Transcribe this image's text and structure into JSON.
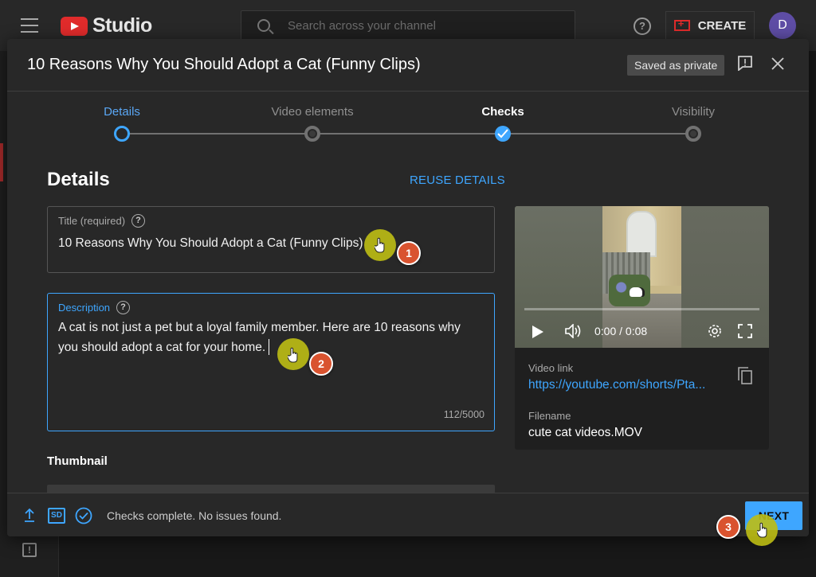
{
  "background": {
    "logo_text": "Studio",
    "search_placeholder": "Search across your channel",
    "create_label": "CREATE",
    "avatar_letter": "D"
  },
  "dialog": {
    "title": "10 Reasons Why You Should Adopt a Cat (Funny Clips)",
    "saved_badge": "Saved as private"
  },
  "steps": [
    {
      "label": "Details",
      "state": "current"
    },
    {
      "label": "Video elements",
      "state": "pending"
    },
    {
      "label": "Checks",
      "state": "done"
    },
    {
      "label": "Visibility",
      "state": "pending"
    }
  ],
  "details": {
    "heading": "Details",
    "reuse_label": "REUSE DETAILS",
    "title_label": "Title (required)",
    "title_value": "10 Reasons Why You Should Adopt a Cat (Funny Clips)",
    "description_label": "Description",
    "description_value": "A cat is not just a pet but a loyal family member. Here are 10 reasons why you should adopt a cat for your home.",
    "description_counter": "112/5000",
    "thumbnail_label": "Thumbnail"
  },
  "preview": {
    "time": "0:00 / 0:08",
    "video_link_label": "Video link",
    "video_link": "https://youtube.com/shorts/Pta...",
    "filename_label": "Filename",
    "filename": "cute cat videos.MOV"
  },
  "footer": {
    "sd_label": "SD",
    "status": "Checks complete. No issues found.",
    "next_label": "NEXT"
  },
  "annotations": [
    "1",
    "2",
    "3"
  ],
  "colors": {
    "accent": "#3ea6ff",
    "dialog_bg": "#282828",
    "badge": "#d9532f",
    "click_highlight": "#bebe14"
  }
}
